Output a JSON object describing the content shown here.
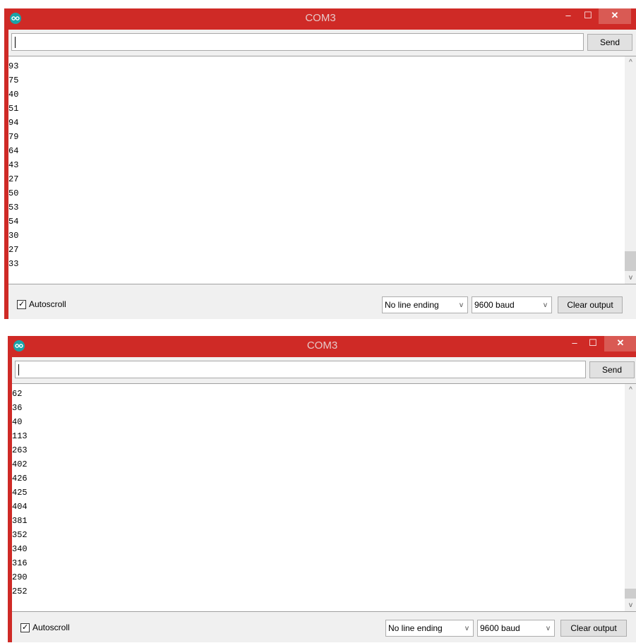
{
  "windows": [
    {
      "title": "COM3",
      "send_label": "Send",
      "input_value": "",
      "output_lines": [
        "93",
        "75",
        "40",
        "51",
        "94",
        "79",
        "64",
        "43",
        "27",
        "50",
        "53",
        "54",
        "30",
        "27",
        "33"
      ],
      "autoscroll_label": "Autoscroll",
      "autoscroll_checked": true,
      "line_ending": "No line ending",
      "baud": "9600 baud",
      "clear_label": "Clear output"
    },
    {
      "title": "COM3",
      "send_label": "Send",
      "input_value": "",
      "output_lines": [
        "62",
        "36",
        "40",
        "113",
        "263",
        "402",
        "426",
        "425",
        "404",
        "381",
        "352",
        "340",
        "316",
        "290",
        "252"
      ],
      "autoscroll_label": "Autoscroll",
      "autoscroll_checked": true,
      "line_ending": "No line ending",
      "baud": "9600 baud",
      "clear_label": "Clear output"
    }
  ],
  "controls": {
    "minimize": "–",
    "maximize": "☐",
    "close": "✕",
    "scroll_up": "^",
    "scroll_down": "v",
    "dropdown_chevron": "v",
    "checkmark": "✓"
  },
  "colors": {
    "titlebar": "#cf2a26",
    "close_button": "#d95a54",
    "client_bg": "#f0f0f0"
  },
  "icons": {
    "app": "arduino-logo-icon",
    "minimize": "minimize-icon",
    "maximize": "maximize-icon",
    "close": "close-icon"
  }
}
